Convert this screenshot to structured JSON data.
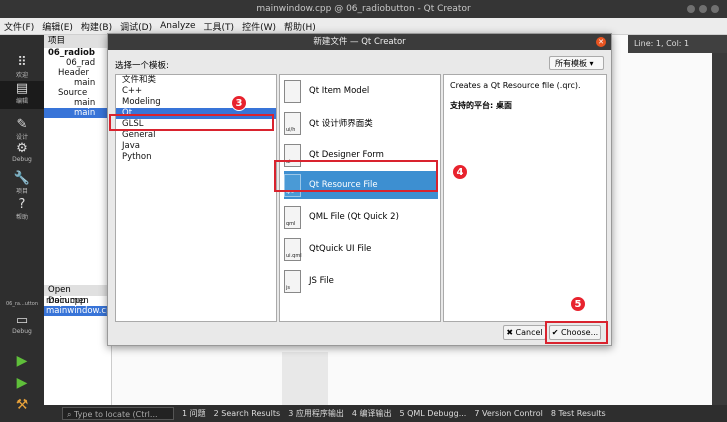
{
  "window": {
    "title": "mainwindow.cpp @ 06_radiobutton - Qt Creator"
  },
  "menu": [
    "文件(F)",
    "编辑(E)",
    "构建(B)",
    "调试(D)",
    "Analyze",
    "工具(T)",
    "控件(W)",
    "帮助(H)"
  ],
  "modes": [
    {
      "label": "欢迎",
      "icon": "⠿"
    },
    {
      "label": "编辑",
      "icon": "▤"
    },
    {
      "label": "设计",
      "icon": "✎"
    },
    {
      "label": "Debug",
      "icon": "⚙"
    },
    {
      "label": "项目",
      "icon": "🔧"
    },
    {
      "label": "帮助",
      "icon": "?"
    }
  ],
  "kit": {
    "project": "06_ra...utton",
    "config": "Debug"
  },
  "project_panel": {
    "header": "项目",
    "rows": [
      "06_radiob",
      "06_rad",
      "Header",
      "main",
      "Source",
      "main",
      "main"
    ]
  },
  "open_docs": {
    "header": "Open Documen",
    "files": [
      "main.cpp",
      "mainwindow.cp"
    ]
  },
  "editor_status": {
    "position": "Line: 1, Col: 1"
  },
  "statusbar": {
    "locator_placeholder": "Type to locate (Ctrl...",
    "items": [
      "1 问题",
      "2 Search Results",
      "3 应用程序输出",
      "4 编译输出",
      "5 QML Debugg...",
      "7 Version Control",
      "8 Test Results"
    ]
  },
  "dialog": {
    "title": "新建文件 — Qt Creator",
    "choose_label": "选择一个模板:",
    "filter": "所有模板",
    "categories": [
      "文件和类",
      "C++",
      "Modeling",
      "Qt",
      "GLSL",
      "General",
      "Java",
      "Python"
    ],
    "templates": [
      {
        "label": "Qt Item Model",
        "icon": ""
      },
      {
        "label": "Qt 设计师界面类",
        "icon": "ui/h"
      },
      {
        "label": "Qt Designer Form",
        "icon": "ui"
      },
      {
        "label": "Qt Resource File",
        "icon": "qrc"
      },
      {
        "label": "QML File (Qt Quick 2)",
        "icon": "qml"
      },
      {
        "label": "QtQuick UI File",
        "icon": "ui.qml"
      },
      {
        "label": "JS File",
        "icon": "js"
      }
    ],
    "description": "Creates a Qt Resource file (.qrc).",
    "platforms": "支持的平台: 桌面",
    "cancel": "✖ Cancel",
    "choose": "✔ Choose..."
  },
  "annotations": [
    "3",
    "4",
    "5"
  ],
  "colors": {
    "highlight": "#d9232e",
    "selection": "#3874d8"
  }
}
